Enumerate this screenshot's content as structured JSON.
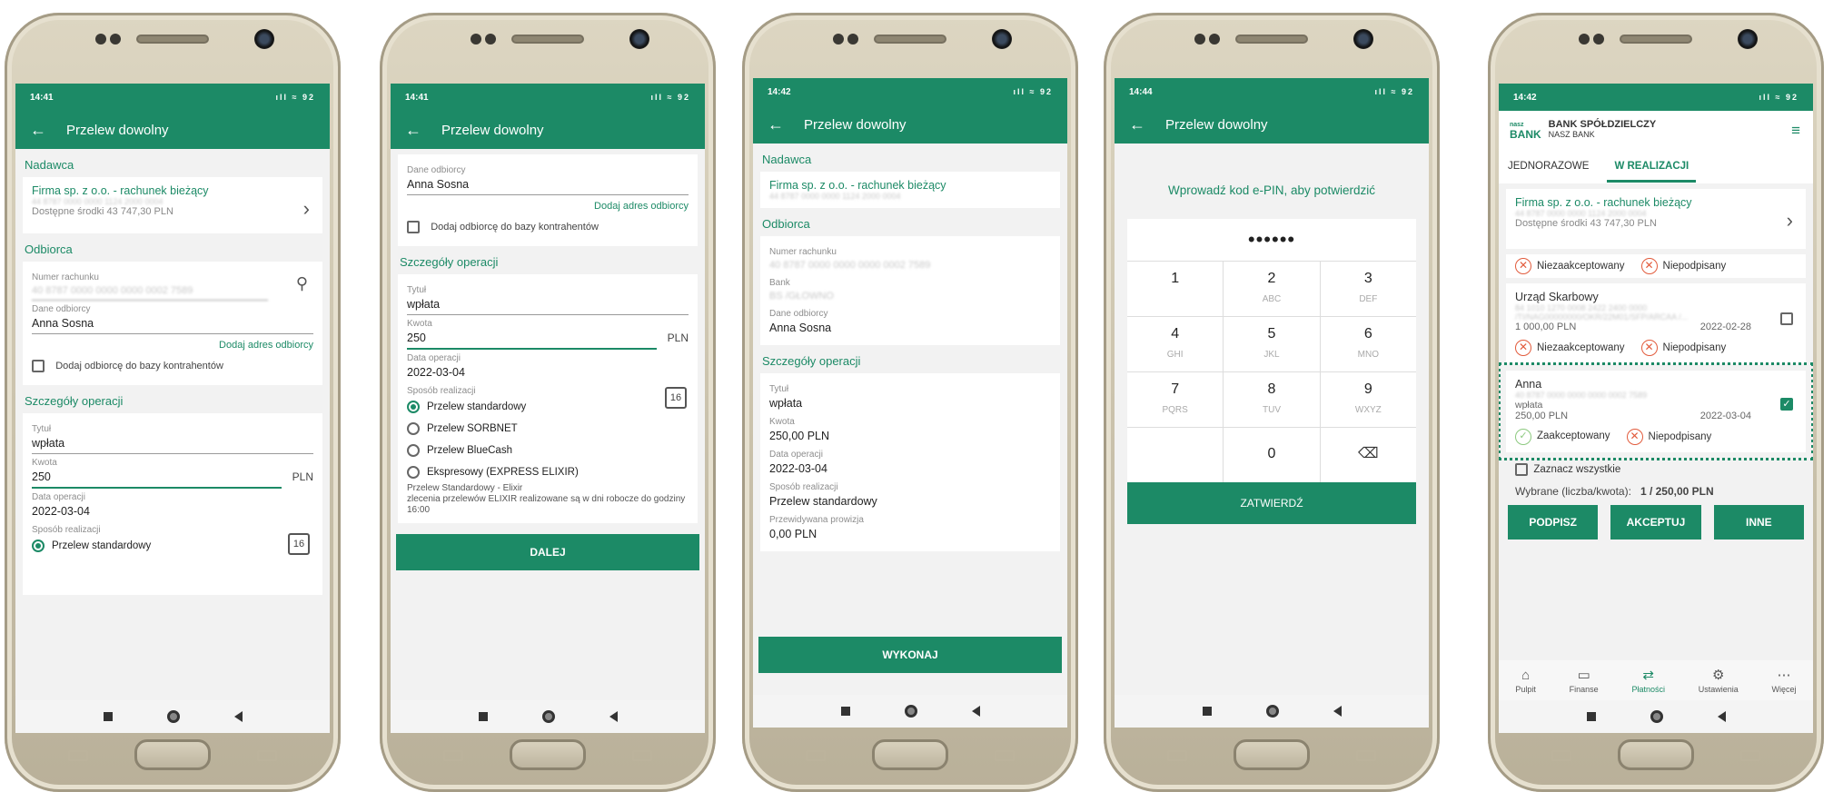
{
  "phone1": {
    "time": "14:41",
    "status_icons": "ıll ≈ 92",
    "title": "Przelew dowolny",
    "sender_section": "Nadawca",
    "account_name": "Firma sp. z o.o. - rachunek bieżący",
    "account_no": "44 8787 0000 0000 1124 2000 0004",
    "available": "Dostępne środki 43 747,30 PLN",
    "recipient_section": "Odbiorca",
    "acct_label": "Numer rachunku",
    "acct_value": "40 8787 0000 0000 0000 0002 7589",
    "name_label": "Dane odbiorcy",
    "name_value": "Anna Sosna",
    "add_address": "Dodaj adres odbiorcy",
    "add_to_base": "Dodaj odbiorcę do bazy kontrahentów",
    "details_section": "Szczegóły operacji",
    "title_label": "Tytuł",
    "title_value": "wpłata",
    "amount_label": "Kwota",
    "amount_value": "250",
    "currency": "PLN",
    "date_label": "Data operacji",
    "date_value": "2022-03-04",
    "cal_num": "16",
    "mode_label": "Sposób realizacji",
    "mode_value": "Przelew standardowy"
  },
  "phone2": {
    "time": "14:41",
    "status_icons": "ıll ≈ 92",
    "title": "Przelew dowolny",
    "name_label": "Dane odbiorcy",
    "name_value": "Anna Sosna",
    "add_address": "Dodaj adres odbiorcy",
    "add_to_base": "Dodaj odbiorcę do bazy kontrahentów",
    "details_section": "Szczegóły operacji",
    "title_label": "Tytuł",
    "title_value": "wpłata",
    "amount_label": "Kwota",
    "amount_value": "250",
    "currency": "PLN",
    "date_label": "Data operacji",
    "date_value": "2022-03-04",
    "cal_num": "16",
    "mode_label": "Sposób realizacji",
    "modes": [
      "Przelew standardowy",
      "Przelew SORBNET",
      "Przelew BlueCash",
      "Ekspresowy (EXPRESS ELIXIR)"
    ],
    "info1": "Przelew Standardowy - Elixir",
    "info2": "zlecenia przelewów ELIXIR realizowane są w dni robocze do godziny 16:00",
    "next": "DALEJ"
  },
  "phone3": {
    "time": "14:42",
    "status_icons": "ıll ≈ 92",
    "title": "Przelew dowolny",
    "sender_section": "Nadawca",
    "account_name": "Firma sp. z o.o. - rachunek bieżący",
    "account_no": "44 8787 0000 0000 1124 2000 0004",
    "recipient_section": "Odbiorca",
    "acct_label": "Numer rachunku",
    "acct_value": "40 8787 0000 0000 0000 0002 7589",
    "bank_label": "Bank",
    "bank_value": "BS /GŁOWNO",
    "name_label": "Dane odbiorcy",
    "name_value": "Anna Sosna",
    "details_section": "Szczegóły operacji",
    "title_label": "Tytuł",
    "title_value": "wpłata",
    "amount_label": "Kwota",
    "amount_value": "250,00 PLN",
    "date_label": "Data operacji",
    "date_value": "2022-03-04",
    "mode_label": "Sposób realizacji",
    "mode_value": "Przelew standardowy",
    "fee_label": "Przewidywana prowizja",
    "fee_value": "0,00 PLN",
    "execute": "WYKONAJ"
  },
  "phone4": {
    "time": "14:44",
    "status_icons": "ıll ≈ 92",
    "title": "Przelew dowolny",
    "prompt": "Wprowadź kod e-PIN, aby potwierdzić",
    "pin_mask": "••••••",
    "keys": [
      {
        "d": "1",
        "l": ""
      },
      {
        "d": "2",
        "l": "ABC"
      },
      {
        "d": "3",
        "l": "DEF"
      },
      {
        "d": "4",
        "l": "GHI"
      },
      {
        "d": "5",
        "l": "JKL"
      },
      {
        "d": "6",
        "l": "MNO"
      },
      {
        "d": "7",
        "l": "PQRS"
      },
      {
        "d": "8",
        "l": "TUV"
      },
      {
        "d": "9",
        "l": "WXYZ"
      }
    ],
    "zero": "0",
    "confirm": "ZATWIERDŹ"
  },
  "phone5": {
    "time": "14:42",
    "status_icons": "ıll ≈ 92",
    "bank_name": "BANK SPÓŁDZIELCZY",
    "bank_sub": "NASZ BANK",
    "logo_word": "BANK",
    "logo_small": "nasz",
    "tab1": "JEDNORAZOWE",
    "tab2": "W REALIZACJI",
    "account_name": "Firma sp. z o.o. - rachunek bieżący",
    "account_no": "44 8787 0000 0000 1124 2000 0004",
    "available": "Dostępne środki 43 747,30 PLN",
    "st_unaccepted": "Niezaakceptowany",
    "st_unsigned": "Niepodpisany",
    "st_accepted": "Zaakceptowany",
    "item1_name": "Urząd Skarbowy",
    "item1_acct": "84 1010 1270 0008 2422 2400 0000",
    "item1_desc": "/TI/NAG00000000/OKR/22M01/SFP/ARCAA /...",
    "item1_amount": "1 000,00 PLN",
    "item1_date": "2022-02-28",
    "item2_name": "Anna",
    "item2_acct": "40 8787 0000 0000 0000 0002 7589",
    "item2_title": "wpłata",
    "item2_amount": "250,00 PLN",
    "item2_date": "2022-03-04",
    "select_all": "Zaznacz wszystkie",
    "selected_label": "Wybrane (liczba/kwota):",
    "selected_value": "1 / 250,00 PLN",
    "btn_sign": "PODPISZ",
    "btn_accept": "AKCEPTUJ",
    "btn_other": "INNE",
    "nav": [
      "Pulpit",
      "Finanse",
      "Płatności",
      "Ustawienia",
      "Więcej"
    ]
  },
  "colors": {
    "primary": "#1c8a66",
    "reject": "#e25b3c",
    "accepted": "#8cc97f"
  },
  "icons": [
    "back-arrow-icon",
    "person-icon",
    "calendar-icon",
    "chevron-right-icon",
    "backspace-icon",
    "menu-icon",
    "home-icon",
    "wallet-icon",
    "transfer-icon",
    "gear-icon",
    "more-icon"
  ]
}
